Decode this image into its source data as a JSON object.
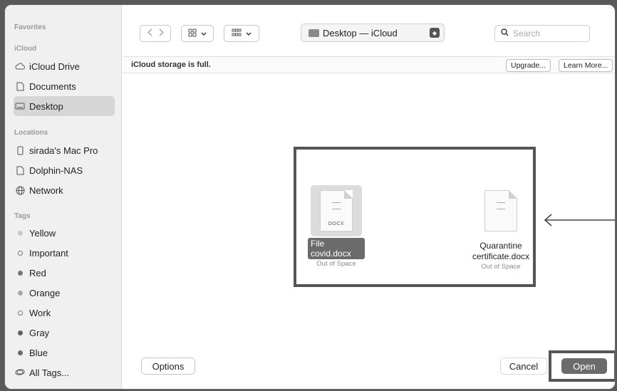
{
  "sidebar": {
    "favorites_heading": "Favorites",
    "icloud_heading": "iCloud",
    "icloud_items": [
      {
        "label": "iCloud Drive",
        "icon": "cloud-icon"
      },
      {
        "label": "Documents",
        "icon": "document-icon"
      },
      {
        "label": "Desktop",
        "icon": "desktop-icon",
        "selected": true
      }
    ],
    "locations_heading": "Locations",
    "location_items": [
      {
        "label": "sirada's Mac Pro",
        "icon": "computer-icon"
      },
      {
        "label": "Dolphin-NAS",
        "icon": "document-icon"
      },
      {
        "label": "Network",
        "icon": "globe-icon"
      }
    ],
    "tags_heading": "Tags",
    "tags": [
      {
        "label": "Yellow",
        "color": "#c8c8c8"
      },
      {
        "label": "Important",
        "color": "hollow"
      },
      {
        "label": "Red",
        "color": "#777777"
      },
      {
        "label": "Orange",
        "color": "#a8a8a8"
      },
      {
        "label": "Work",
        "color": "hollow"
      },
      {
        "label": "Gray",
        "color": "#5f5f5f"
      },
      {
        "label": "Blue",
        "color": "#6a6a6a"
      }
    ],
    "all_tags": "All Tags..."
  },
  "toolbar": {
    "back_icon": "chevron-left-icon",
    "forward_icon": "chevron-right-icon",
    "location": "Desktop — iCloud",
    "search_placeholder": "Search"
  },
  "banner": {
    "message": "iCloud storage is full.",
    "upgrade_label": "Upgrade...",
    "learn_more_label": "Learn More..."
  },
  "files": [
    {
      "name": "File covid.docx",
      "status": "Out of Space",
      "badge": "DOCX",
      "selected": true
    },
    {
      "name": "Quarantine certificate.docx",
      "status": "Out of Space",
      "badge": "",
      "selected": false
    }
  ],
  "footer": {
    "options_label": "Options",
    "cancel_label": "Cancel",
    "open_label": "Open"
  }
}
